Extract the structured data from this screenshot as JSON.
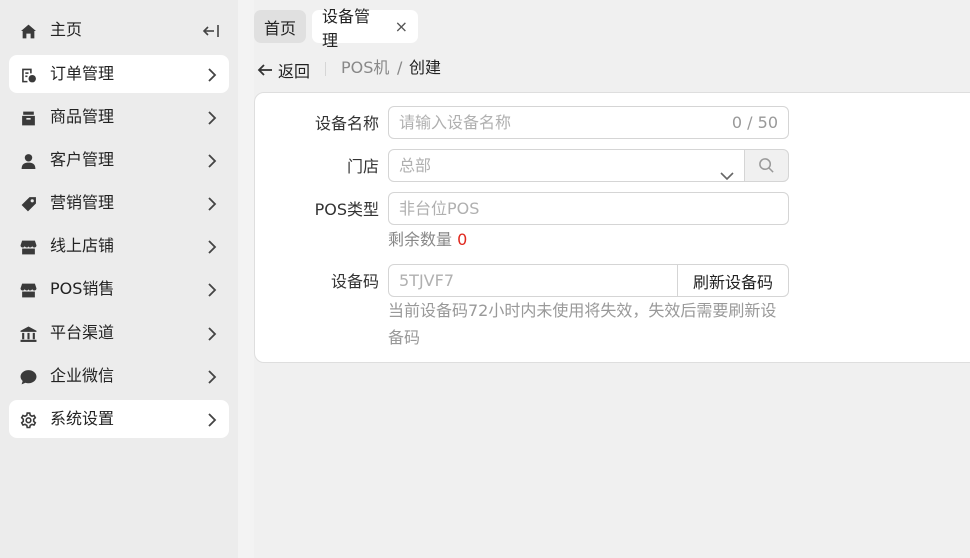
{
  "sidebar": {
    "items": [
      {
        "label": "主页",
        "icon": "home-icon"
      },
      {
        "label": "订单管理",
        "icon": "order-icon"
      },
      {
        "label": "商品管理",
        "icon": "product-icon"
      },
      {
        "label": "客户管理",
        "icon": "customer-icon"
      },
      {
        "label": "营销管理",
        "icon": "tag-icon"
      },
      {
        "label": "线上店铺",
        "icon": "shop-icon"
      },
      {
        "label": "POS销售",
        "icon": "store-icon"
      },
      {
        "label": "平台渠道",
        "icon": "bank-icon"
      },
      {
        "label": "企业微信",
        "icon": "chat-icon"
      },
      {
        "label": "系统设置",
        "icon": "gear-icon"
      }
    ]
  },
  "tabs": {
    "home": "首页",
    "device": "设备管理",
    "close": "×"
  },
  "breadcrumb": {
    "back": "返回",
    "pos": "POS机",
    "slash": "/",
    "create": "创建"
  },
  "form": {
    "name_label": "设备名称",
    "name_placeholder": "请输入设备名称",
    "name_counter": "0 / 50",
    "store_label": "门店",
    "store_value": "总部",
    "pos_type_label": "POS类型",
    "pos_type_value": "非台位POS",
    "remain_label": "剩余数量",
    "remain_count": "0",
    "code_label": "设备码",
    "code_value": "5TJVF7",
    "refresh_button": "刷新设备码",
    "hint": "当前设备码72小时内未使用将失效，失效后需要刷新设备码"
  },
  "colors": {
    "accent_red": "#e0281e",
    "sidebar_bg": "#ececec",
    "content_bg": "#f0f0f0"
  }
}
